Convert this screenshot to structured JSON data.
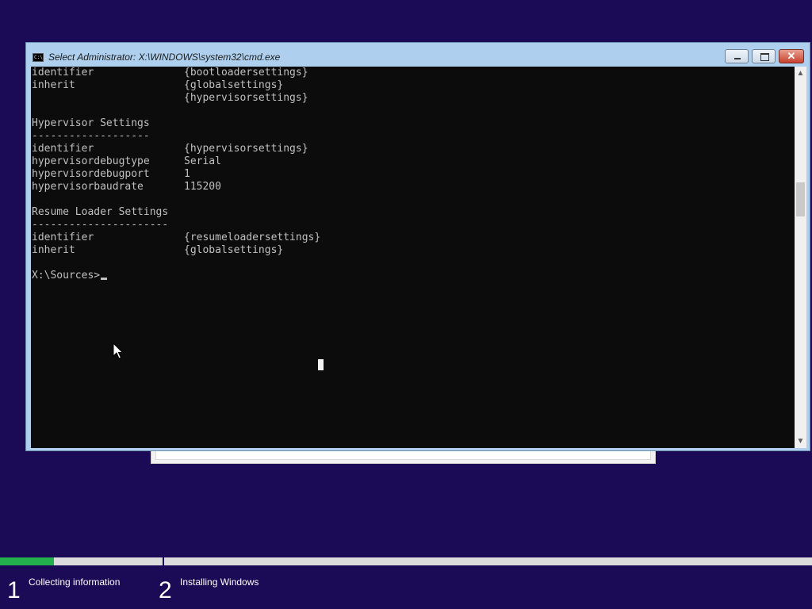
{
  "window": {
    "title": "Select Administrator: X:\\WINDOWS\\system32\\cmd.exe",
    "icon": "cmd-console-icon",
    "icon_text": "C:\\"
  },
  "console": {
    "lines": [
      {
        "key": "identifier",
        "value": "{bootloadersettings}"
      },
      {
        "key": "inherit",
        "value": "{globalsettings}"
      },
      {
        "key": "",
        "value": "{hypervisorsettings}"
      },
      {
        "key": "",
        "value": ""
      },
      {
        "key": "Hypervisor Settings",
        "value": ""
      },
      {
        "key": "-------------------",
        "value": ""
      },
      {
        "key": "identifier",
        "value": "{hypervisorsettings}"
      },
      {
        "key": "hypervisordebugtype",
        "value": "Serial"
      },
      {
        "key": "hypervisordebugport",
        "value": "1"
      },
      {
        "key": "hypervisorbaudrate",
        "value": "115200"
      },
      {
        "key": "",
        "value": ""
      },
      {
        "key": "Resume Loader Settings",
        "value": ""
      },
      {
        "key": "----------------------",
        "value": ""
      },
      {
        "key": "identifier",
        "value": "{resumeloadersettings}"
      },
      {
        "key": "inherit",
        "value": "{globalsettings}"
      },
      {
        "key": "",
        "value": ""
      }
    ],
    "prompt": "X:\\Sources>",
    "foreground": "#c0c0c0",
    "background": "#0c0c0c"
  },
  "setup": {
    "progress": 0.33,
    "accent": "#22b14c",
    "background": "#1b0a56",
    "steps": [
      {
        "number": "1",
        "label": "Collecting information"
      },
      {
        "number": "2",
        "label": "Installing Windows"
      }
    ]
  }
}
